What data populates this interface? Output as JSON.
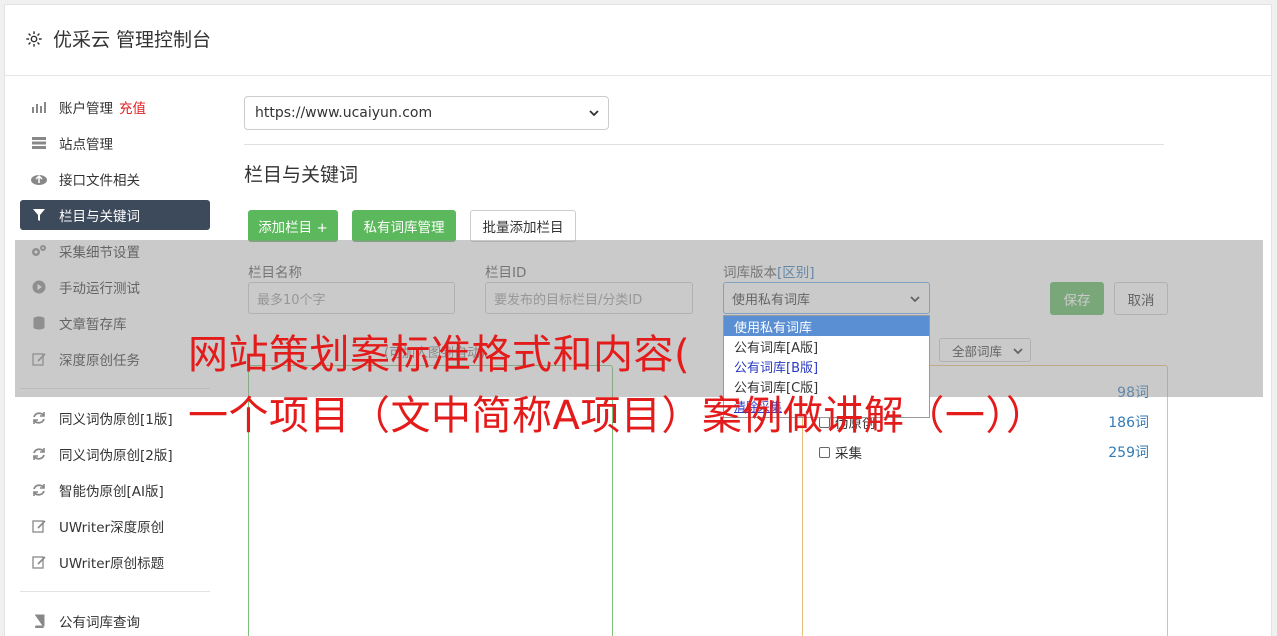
{
  "header": {
    "title": "优采云 管理控制台",
    "icon": "gear-icon"
  },
  "sidebar": {
    "items": [
      {
        "label": "账户管理",
        "badge": "充值",
        "icon": "bar-chart-icon"
      },
      {
        "label": "站点管理",
        "icon": "server-icon"
      },
      {
        "label": "接口文件相关",
        "icon": "cloud-upload-icon"
      },
      {
        "label": "栏目与关键词",
        "icon": "filter-icon",
        "active": true
      },
      {
        "label": "采集细节设置",
        "icon": "cogs-icon"
      },
      {
        "label": "手动运行测试",
        "icon": "play-circle-icon"
      },
      {
        "label": "文章暂存库",
        "icon": "database-icon"
      },
      {
        "label": "深度原创任务",
        "icon": "edit-icon"
      }
    ],
    "items2": [
      {
        "label": "同义词伪原创[1版]",
        "icon": "refresh-icon"
      },
      {
        "label": "同义词伪原创[2版]",
        "icon": "refresh-icon"
      },
      {
        "label": "智能伪原创[AI版]",
        "icon": "refresh-icon"
      },
      {
        "label": "UWriter深度原创",
        "icon": "edit-icon"
      },
      {
        "label": "UWriter原创标题",
        "icon": "edit-icon"
      }
    ],
    "items3": [
      {
        "label": "公有词库查询",
        "icon": "book-icon"
      }
    ]
  },
  "main": {
    "site_select_value": "https://www.ucaiyun.com",
    "section_title": "栏目与关键词",
    "buttons": {
      "add_column": "添加栏目 +",
      "private_lib": "私有词库管理",
      "batch_add": "批量添加栏目"
    },
    "form": {
      "name_label": "栏目名称",
      "name_placeholder": "最多10个字",
      "id_label": "栏目ID",
      "id_placeholder": "要发布的目标栏目/分类ID",
      "version_label": "词库版本",
      "version_link": "[区别]",
      "version_value": "使用私有词库",
      "save": "保存",
      "cancel": "取消"
    },
    "hint_text": "(可加人图到自动)",
    "all_libs": "全部词库",
    "dropdown_options": [
      "使用私有词库",
      "公有词库[A版]",
      "公有词库[B版]",
      "公有词库[C版]"
    ],
    "link_fragment": "清除采集",
    "lib_rows": [
      {
        "label": "",
        "count": "98词"
      },
      {
        "label": "伪原创",
        "count": "186词"
      },
      {
        "label": "采集",
        "count": "259词"
      }
    ]
  },
  "banner": {
    "line1": "网站策划案标准格式和内容(",
    "line2": "一个项目（文中简称A项目）案例做讲解（一））"
  },
  "colors": {
    "accent_green": "#5cb85c",
    "active_nav": "#3d4a5c",
    "banner_red": "#e31b1b",
    "link_blue": "#337ab7"
  }
}
